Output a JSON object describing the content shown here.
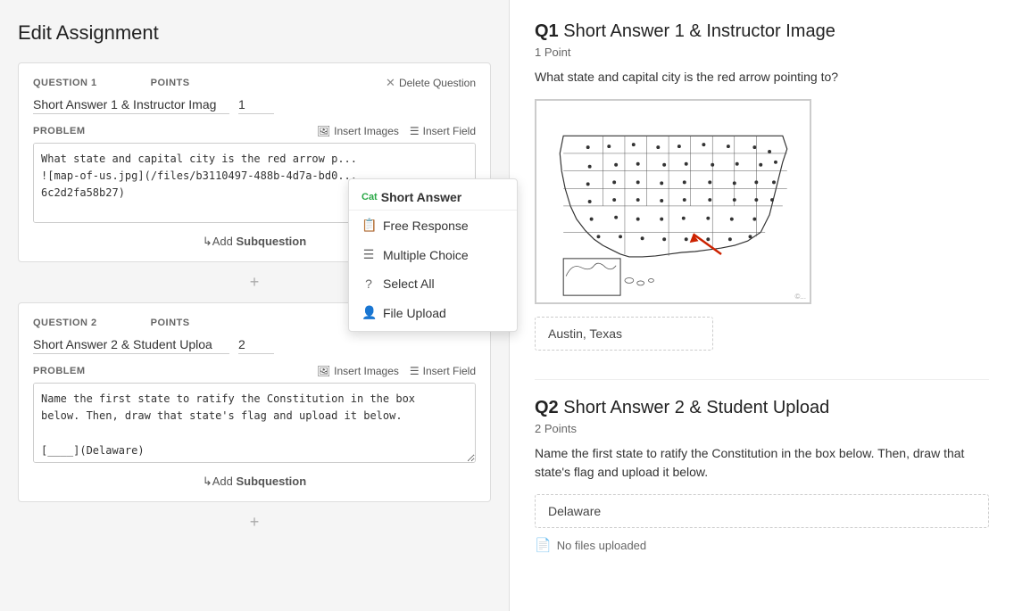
{
  "page": {
    "title": "Edit Assignment"
  },
  "questions": [
    {
      "label": "QUESTION 1",
      "points_label": "POINTS",
      "name_value": "Short Answer 1 & Instructor Imag",
      "points_value": "1",
      "problem_label": "PROBLEM",
      "problem_text": "What state and capital city is the red arrow p...\n![map-of-us.jpg](/files/b3110497-488b-4d7a-bd0...\n6c2d2fa58b27)\n\n[____](Austin, Texas)",
      "delete_label": "Delete Question",
      "insert_images_label": "Insert Images",
      "insert_field_label": "Insert Field",
      "add_subquestion_label": "Add Subquestion"
    },
    {
      "label": "QUESTION 2",
      "points_label": "POINTS",
      "name_value": "Short Answer 2 & Student Uploa",
      "points_value": "2",
      "problem_label": "PROBLEM",
      "problem_text": "Name the first state to ratify the Constitution in the box\nbelow. Then, draw that state's flag and upload it below.\n\n[____](Delaware)\n\n|files|",
      "delete_label": "Delete Question",
      "insert_images_label": "Insert Images",
      "insert_field_label": "Insert Field",
      "add_subquestion_label": "Add Subquestion"
    }
  ],
  "dropdown": {
    "cat_label": "Cat",
    "title": "Short Answer",
    "items": [
      {
        "icon": "📄",
        "label": "Free Response"
      },
      {
        "icon": "☰",
        "label": "Multiple Choice"
      },
      {
        "icon": "?",
        "label": "Select All"
      },
      {
        "icon": "👤",
        "label": "File Upload"
      }
    ]
  },
  "preview": {
    "q1": {
      "label": "Q1",
      "title": "Short Answer 1 & Instructor Image",
      "points": "1 Point",
      "problem": "What state and capital city is the red arrow pointing to?",
      "answer": "Austin, Texas"
    },
    "q2": {
      "label": "Q2",
      "title": "Short Answer 2 & Student Upload",
      "points": "2 Points",
      "problem": "Name the first state to ratify the Constitution in the box below. Then, draw that state's flag and upload it below.",
      "answer": "Delaware",
      "no_files": "No files uploaded"
    }
  },
  "icons": {
    "insert_images": "🖼",
    "insert_field": "☰",
    "delete_x": "✕",
    "add_plus": "+",
    "file_upload": "📄"
  }
}
